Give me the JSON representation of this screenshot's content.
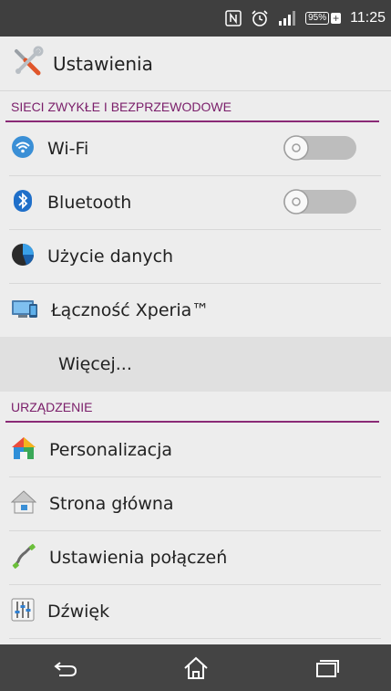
{
  "status_bar": {
    "battery_level": "95%",
    "time": "11:25",
    "icons": [
      "nfc-icon",
      "alarm-icon",
      "signal-icon",
      "battery-icon"
    ]
  },
  "header": {
    "title": "Ustawienia",
    "icon": "settings-tools-icon"
  },
  "sections": [
    {
      "title": "SIECI ZWYKŁE I BEZPRZEWODOWE",
      "items": [
        {
          "label": "Wi-Fi",
          "icon": "wifi-icon",
          "toggle": false
        },
        {
          "label": "Bluetooth",
          "icon": "bluetooth-icon",
          "toggle": false
        },
        {
          "label": "Użycie danych",
          "icon": "data-usage-icon"
        },
        {
          "label": "Łączność Xperia™",
          "icon": "xperia-connectivity-icon"
        },
        {
          "label": "Więcej...",
          "icon": ""
        }
      ]
    },
    {
      "title": "URZĄDZENIE",
      "items": [
        {
          "label": "Personalizacja",
          "icon": "personalization-icon"
        },
        {
          "label": "Strona główna",
          "icon": "home-screen-icon"
        },
        {
          "label": "Ustawienia połączeń",
          "icon": "phone-call-icon"
        },
        {
          "label": "Dźwięk",
          "icon": "sound-equalizer-icon"
        }
      ]
    }
  ],
  "nav_bar": {
    "icons": [
      "back-icon",
      "home-icon",
      "recent-apps-icon"
    ]
  },
  "colors": {
    "accent": "#8a2a76",
    "status_bar": "#3f3f3f",
    "nav_bar": "#444444",
    "background": "#ededed"
  }
}
